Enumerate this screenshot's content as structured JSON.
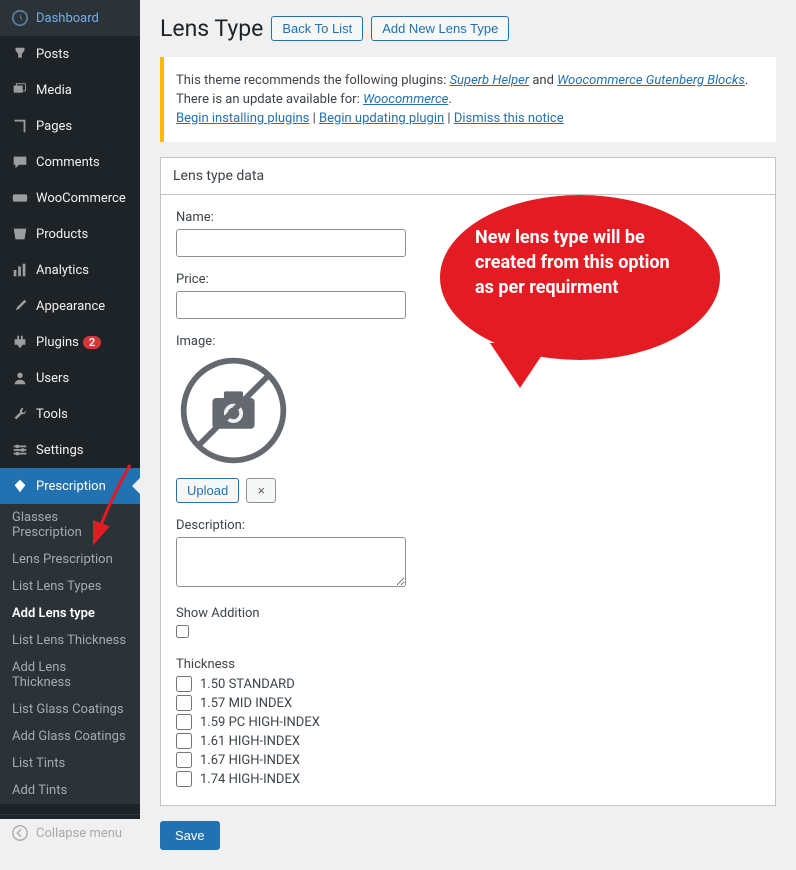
{
  "sidebar": {
    "items": [
      {
        "label": "Dashboard",
        "icon": "dashboard"
      },
      {
        "label": "Posts",
        "icon": "pin"
      },
      {
        "label": "Media",
        "icon": "media"
      },
      {
        "label": "Pages",
        "icon": "page"
      },
      {
        "label": "Comments",
        "icon": "comment"
      },
      {
        "label": "WooCommerce",
        "icon": "woo"
      },
      {
        "label": "Products",
        "icon": "product"
      },
      {
        "label": "Analytics",
        "icon": "analytics"
      },
      {
        "label": "Appearance",
        "icon": "brush"
      },
      {
        "label": "Plugins",
        "icon": "plugin",
        "badge": "2"
      },
      {
        "label": "Users",
        "icon": "user"
      },
      {
        "label": "Tools",
        "icon": "wrench"
      },
      {
        "label": "Settings",
        "icon": "settings"
      },
      {
        "label": "Prescription",
        "icon": "diamond",
        "active": true
      }
    ],
    "submenu": [
      {
        "label": "Glasses Prescription"
      },
      {
        "label": "Lens Prescription"
      },
      {
        "label": "List Lens Types"
      },
      {
        "label": "Add Lens type",
        "current": true
      },
      {
        "label": "List Lens Thickness"
      },
      {
        "label": "Add Lens Thickness"
      },
      {
        "label": "List Glass Coatings"
      },
      {
        "label": "Add Glass Coatings"
      },
      {
        "label": "List Tints"
      },
      {
        "label": "Add Tints"
      }
    ],
    "collapse": "Collapse menu"
  },
  "header": {
    "title": "Lens Type",
    "back_button": "Back To List",
    "add_button": "Add New Lens Type"
  },
  "notice": {
    "line1_prefix": "This theme recommends the following plugins: ",
    "plugin1": "Superb Helper",
    "and": " and ",
    "plugin2": "Woocommerce Gutenberg Blocks",
    "period": ".",
    "line2_prefix": "There is an update available for: ",
    "plugin3": "Woocommerce",
    "link1": "Begin installing plugins",
    "link2": "Begin updating plugin",
    "link3": "Dismiss this notice",
    "sep": " | "
  },
  "panel": {
    "title": "Lens type data",
    "name_label": "Name:",
    "name_value": "",
    "price_label": "Price:",
    "price_value": "",
    "image_label": "Image:",
    "upload_btn": "Upload",
    "clear_btn": "×",
    "description_label": "Description:",
    "description_value": "",
    "show_addition_label": "Show Addition",
    "thickness_label": "Thickness",
    "thickness_options": [
      "1.50 STANDARD",
      "1.57 MID INDEX",
      "1.59 PC HIGH-INDEX",
      "1.61 HIGH-INDEX",
      "1.67 HIGH-INDEX",
      "1.74 HIGH-INDEX"
    ],
    "save_btn": "Save"
  },
  "callout": {
    "text": "New lens type will be created from this option as per requirment"
  }
}
